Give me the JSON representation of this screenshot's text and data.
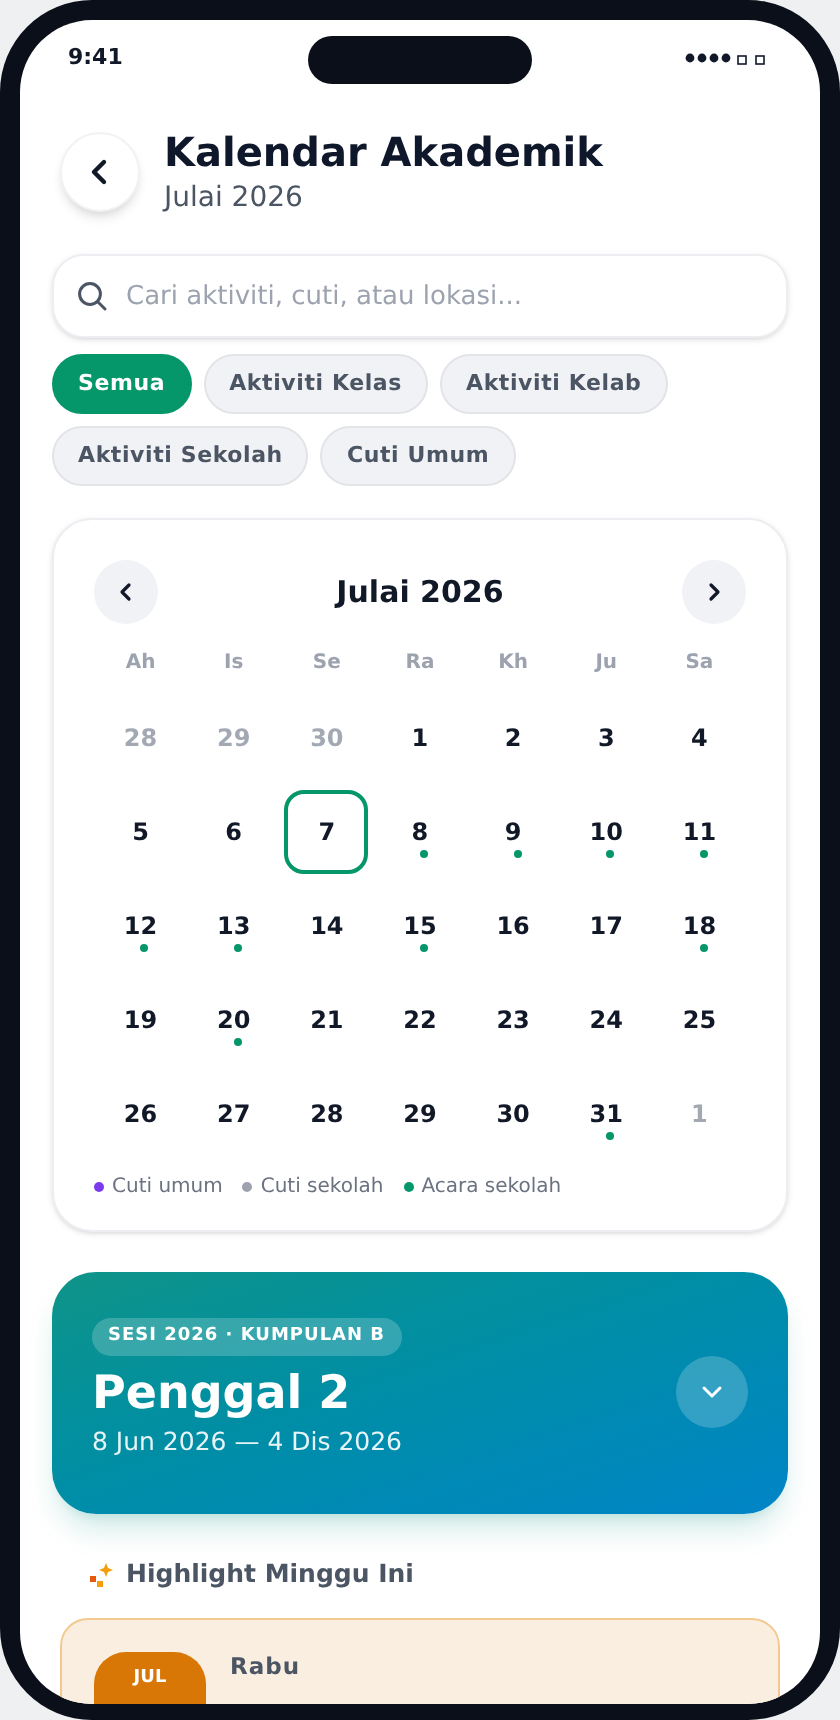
{
  "status_bar": {
    "time": "9:41"
  },
  "header": {
    "title": "Kalendar Akademik",
    "subtitle": "Julai 2026"
  },
  "search": {
    "placeholder": "Cari aktiviti, cuti, atau lokasi..."
  },
  "filters": [
    {
      "label": "Semua",
      "selected": true
    },
    {
      "label": "Aktiviti Kelas",
      "selected": false
    },
    {
      "label": "Aktiviti Kelab",
      "selected": false
    },
    {
      "label": "Aktiviti Sekolah",
      "selected": false
    },
    {
      "label": "Cuti Umum",
      "selected": false
    }
  ],
  "calendar": {
    "month": "Julai 2026",
    "weekdays": [
      "Ah",
      "Is",
      "Se",
      "Ra",
      "Kh",
      "Ju",
      "Sa"
    ],
    "days": [
      {
        "day": "28",
        "muted": true,
        "selected": false
      },
      {
        "day": "29",
        "muted": true,
        "selected": false
      },
      {
        "day": "30",
        "muted": true,
        "selected": false
      },
      {
        "day": "1",
        "muted": false,
        "selected": false
      },
      {
        "day": "2",
        "muted": false,
        "selected": false
      },
      {
        "day": "3",
        "muted": false,
        "selected": false
      },
      {
        "day": "4",
        "muted": false,
        "selected": false
      },
      {
        "day": "5",
        "muted": false,
        "selected": false
      },
      {
        "day": "6",
        "muted": false,
        "selected": false
      },
      {
        "day": "7",
        "muted": false,
        "selected": true
      },
      {
        "day": "8",
        "muted": false,
        "selected": false,
        "color": "#059669"
      },
      {
        "day": "9",
        "muted": false,
        "selected": false,
        "color": "#059669"
      },
      {
        "day": "10",
        "muted": false,
        "selected": false,
        "color": "#059669"
      },
      {
        "day": "11",
        "muted": false,
        "selected": false,
        "color": "#059669"
      },
      {
        "day": "12",
        "muted": false,
        "selected": false,
        "color": "#059669"
      },
      {
        "day": "13",
        "muted": false,
        "selected": false,
        "color": "#059669"
      },
      {
        "day": "14",
        "muted": false,
        "selected": false
      },
      {
        "day": "15",
        "muted": false,
        "selected": false,
        "color": "#059669"
      },
      {
        "day": "16",
        "muted": false,
        "selected": false
      },
      {
        "day": "17",
        "muted": false,
        "selected": false
      },
      {
        "day": "18",
        "muted": false,
        "selected": false,
        "color": "#059669"
      },
      {
        "day": "19",
        "muted": false,
        "selected": false
      },
      {
        "day": "20",
        "muted": false,
        "selected": false,
        "color": "#059669"
      },
      {
        "day": "21",
        "muted": false,
        "selected": false
      },
      {
        "day": "22",
        "muted": false,
        "selected": false
      },
      {
        "day": "23",
        "muted": false,
        "selected": false
      },
      {
        "day": "24",
        "muted": false,
        "selected": false
      },
      {
        "day": "25",
        "muted": false,
        "selected": false
      },
      {
        "day": "26",
        "muted": false,
        "selected": false
      },
      {
        "day": "27",
        "muted": false,
        "selected": false
      },
      {
        "day": "28",
        "muted": false,
        "selected": false
      },
      {
        "day": "29",
        "muted": false,
        "selected": false
      },
      {
        "day": "30",
        "muted": false,
        "selected": false
      },
      {
        "day": "31",
        "muted": false,
        "selected": false,
        "color": "#059669"
      },
      {
        "day": "1",
        "muted": true,
        "selected": false
      }
    ],
    "legend": [
      {
        "label": "Cuti umum",
        "color": "#7c3aed"
      },
      {
        "label": "Cuti sekolah",
        "color": "#9ca3af"
      },
      {
        "label": "Acara sekolah",
        "color": "#059669"
      }
    ]
  },
  "term": {
    "badge": "SESI 2026 · KUMPULAN B",
    "title": "Penggal 2",
    "dates": "8 Jun 2026 — 4 Dis 2026"
  },
  "highlights": {
    "title": "Highlight Minggu Ini",
    "items": [
      {
        "month": "JUL",
        "weekday": "Rabu"
      }
    ]
  }
}
